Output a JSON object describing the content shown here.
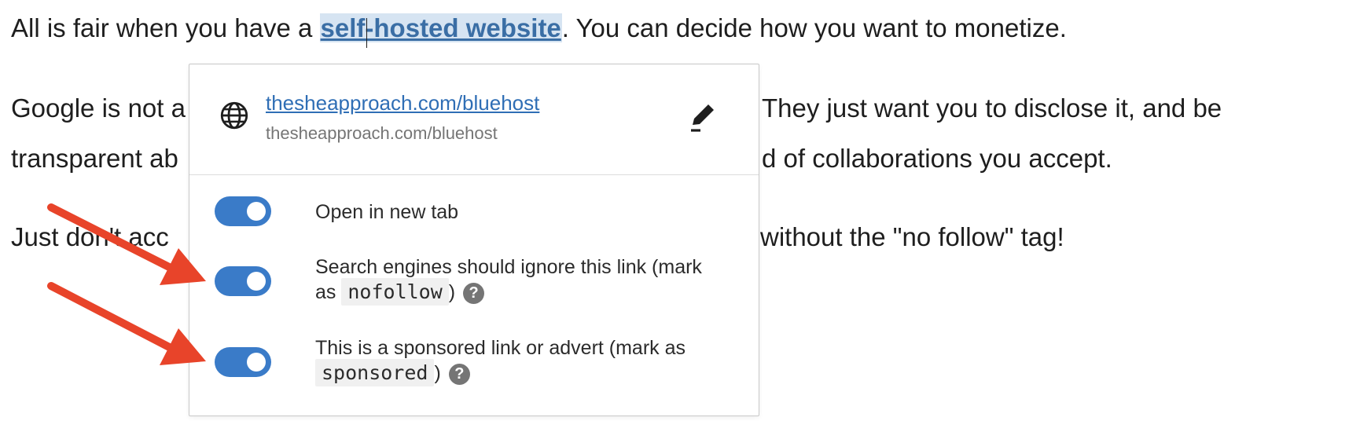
{
  "paragraphs": {
    "p1_before": "All is fair when you have a ",
    "p1_link": "self-hosted website",
    "p1_after": ". You can decide how you want to monetize.",
    "p2_line1_left": "Google is not a",
    "p2_line1_right": "They just want you to disclose it, and be",
    "p2_line2_left": "transparent ab",
    "p2_line2_right": "d of collaborations you accept.",
    "p3_left": "Just don't acc",
    "p3_right": "without the \"no follow\" tag!"
  },
  "link_popover": {
    "url_link": "thesheapproach.com/bluehost",
    "url_display": "thesheapproach.com/bluehost",
    "icons": {
      "site": "globe-icon",
      "edit": "pencil-edit-icon"
    },
    "options": [
      {
        "label": "Open in new tab",
        "enabled": true
      },
      {
        "label_line1": "Search engines should ignore this link (mark",
        "label_pre": "as",
        "code": "nofollow",
        "label_post": ")",
        "help": "?",
        "enabled": true
      },
      {
        "label_line1": "This is a sponsored link or advert (mark as",
        "code": "sponsored",
        "label_post": ")",
        "help": "?",
        "enabled": true
      }
    ]
  },
  "colors": {
    "accent_toggle": "#3a7bc8",
    "link": "#2f6eb5",
    "selection": "#d6e4f2",
    "annotation_arrow": "#e8442a"
  }
}
